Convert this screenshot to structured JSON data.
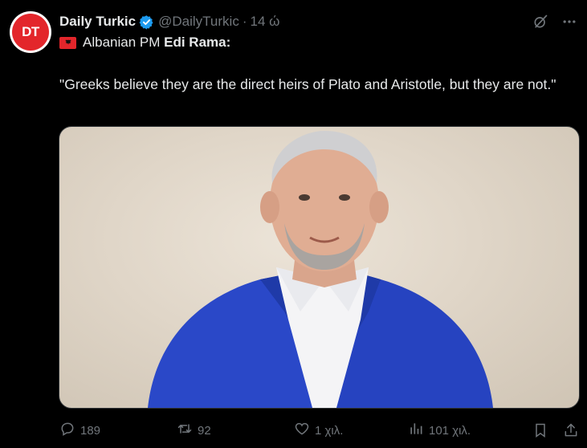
{
  "avatar": {
    "text": "DT",
    "color": "#e3262b"
  },
  "header": {
    "display_name": "Daily Turkic",
    "handle": "@DailyTurkic",
    "separator": "·",
    "time": "14 ώ"
  },
  "tweet": {
    "line1_prefix": "Albanian PM ",
    "line1_name": "Edi Rama:",
    "quote": "\"Greeks believe they are the direct heirs of Plato and Aristotle, but they are not.\""
  },
  "actions": {
    "replies": "189",
    "retweets": "92",
    "likes": "1 χιλ.",
    "views": "101 χιλ."
  },
  "colors": {
    "background": "#000000",
    "text": "#e7e9ea",
    "muted": "#71767b",
    "verified": "#1d9bf0",
    "brand_red": "#e3262b"
  }
}
